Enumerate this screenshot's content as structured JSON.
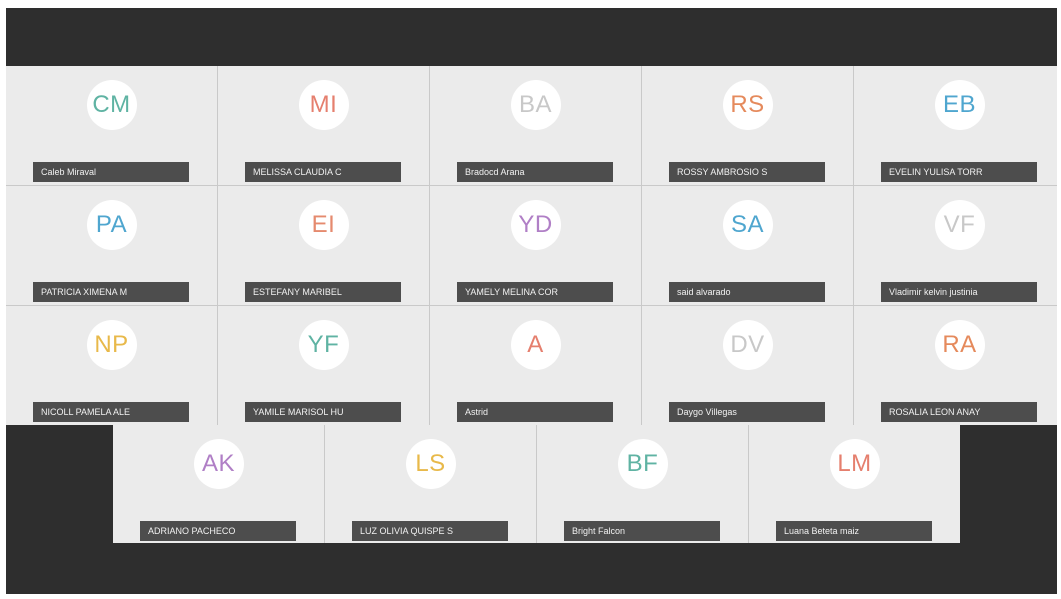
{
  "participants_main": [
    {
      "initials": "CM",
      "name": "Caleb Miraval",
      "color": "#5fb3a3"
    },
    {
      "initials": "MI",
      "name": "MELISSA CLAUDIA C",
      "color": "#e57f6e"
    },
    {
      "initials": "BA",
      "name": "Bradocd Arana",
      "color": "#c8c8c8"
    },
    {
      "initials": "RS",
      "name": "ROSSY AMBROSIO S",
      "color": "#e58a5c"
    },
    {
      "initials": "EB",
      "name": "EVELIN YULISA TORR",
      "color": "#4fa6cf"
    },
    {
      "initials": "PA",
      "name": "PATRICIA XIMENA M",
      "color": "#4fa6cf"
    },
    {
      "initials": "EI",
      "name": "ESTEFANY MARIBEL",
      "color": "#e58a6e"
    },
    {
      "initials": "YD",
      "name": "YAMELY MELINA COR",
      "color": "#b07fc6"
    },
    {
      "initials": "SA",
      "name": "said alvarado",
      "color": "#4fa6cf"
    },
    {
      "initials": "VF",
      "name": "Vladimir kelvin justinia",
      "color": "#c8c8c8"
    },
    {
      "initials": "NP",
      "name": "NICOLL PAMELA ALE",
      "color": "#e8b94a"
    },
    {
      "initials": "YF",
      "name": "YAMILE MARISOL HU",
      "color": "#5fb3a3"
    },
    {
      "initials": "A",
      "name": "Astrid",
      "color": "#e57f6e"
    },
    {
      "initials": "DV",
      "name": "Daygo Villegas",
      "color": "#c8c8c8"
    },
    {
      "initials": "RA",
      "name": "ROSALIA LEON ANAY",
      "color": "#e58a5c"
    }
  ],
  "participants_last": [
    {
      "initials": "AK",
      "name": "ADRIANO PACHECO",
      "color": "#b07fc6"
    },
    {
      "initials": "LS",
      "name": "LUZ OLIVIA QUISPE S",
      "color": "#e8b94a"
    },
    {
      "initials": "BF",
      "name": "Bright Falcon",
      "color": "#5fb3a3"
    },
    {
      "initials": "LM",
      "name": "Luana Beteta maiz",
      "color": "#e57f6e"
    }
  ]
}
